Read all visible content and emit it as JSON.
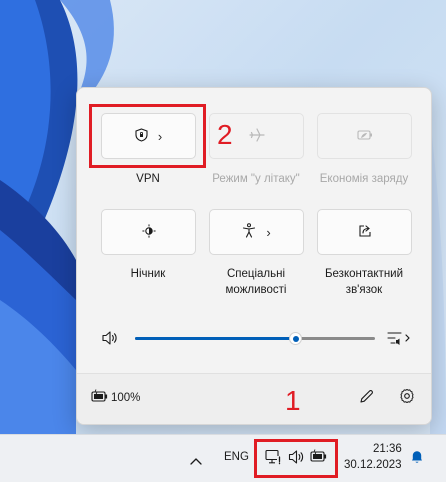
{
  "quick_settings": {
    "tiles_row1": [
      {
        "label": "VPN",
        "icon": "shield-icon",
        "has_chevron": true,
        "disabled": false
      },
      {
        "label": "Режим \"у літаку\"",
        "icon": "airplane-icon",
        "has_chevron": false,
        "disabled": true
      },
      {
        "label": "Економія заряду",
        "icon": "battery-saver-icon",
        "has_chevron": false,
        "disabled": true
      }
    ],
    "tiles_row2": [
      {
        "label": "Нічник",
        "icon": "night-light-icon",
        "has_chevron": false,
        "disabled": false
      },
      {
        "label_line1": "Спеціальні",
        "label_line2": "можливості",
        "icon": "accessibility-icon",
        "has_chevron": true,
        "disabled": false
      },
      {
        "label_line1": "Безконтактний",
        "label_line2": "зв'язок",
        "icon": "nearby-share-icon",
        "has_chevron": false,
        "disabled": false
      }
    ],
    "volume": {
      "level_percent": 67,
      "icon": "speaker-icon",
      "output_icon": "audio-output-icon"
    },
    "battery": {
      "text": "100%",
      "icon": "battery-charging-icon"
    },
    "footer_icons": [
      "edit-pencil-icon",
      "settings-gear-icon"
    ]
  },
  "taskbar": {
    "language": "ENG",
    "time": "21:36",
    "date": "30.12.2023",
    "tray_icons": [
      "chevron-up-icon",
      "network-icon",
      "volume-icon",
      "battery-icon",
      "notification-bell-icon"
    ]
  },
  "annotations": {
    "label_1": "1",
    "label_2": "2"
  },
  "colors": {
    "accent": "#005fb8",
    "annotation_red": "#e01c24"
  }
}
